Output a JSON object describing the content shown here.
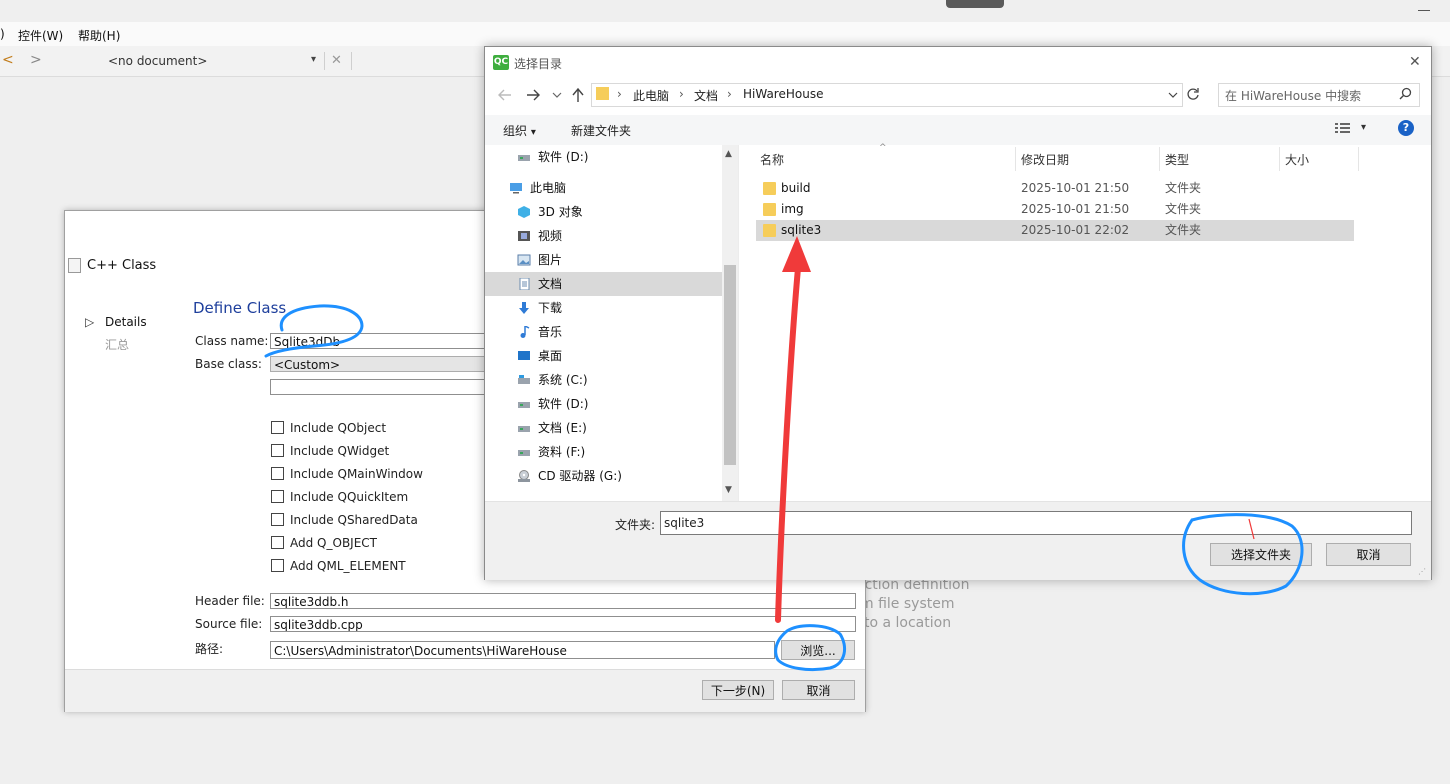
{
  "menu": {
    "items": [
      "控件(W)",
      "帮助(H)"
    ]
  },
  "toolbar": {
    "back": "<",
    "forward": ">",
    "document_combo": "<no document>",
    "combo_arrow": "▾",
    "close": "✕"
  },
  "background": {
    "lines": [
      "action definition",
      "m file system",
      "to a location"
    ]
  },
  "wizard": {
    "title": "C++ Class",
    "steps": [
      "Details",
      "汇总"
    ],
    "step_marker": "▷",
    "section_title": "Define Class",
    "class_name_label": "Class name:",
    "class_name_value": "Sqlite3dDb",
    "base_class_label": "Base class:",
    "base_class_value": "<Custom>",
    "base_class_custom_value": "",
    "checkboxes": [
      "Include QObject",
      "Include QWidget",
      "Include QMainWindow",
      "Include QQuickItem",
      "Include QSharedData",
      "Add Q_OBJECT",
      "Add QML_ELEMENT"
    ],
    "header_file_label": "Header file:",
    "header_file_value": "sqlite3ddb.h",
    "source_file_label": "Source file:",
    "source_file_value": "sqlite3ddb.cpp",
    "path_label": "路径:",
    "path_value": "C:\\Users\\Administrator\\Documents\\HiWareHouse",
    "browse_button": "浏览...",
    "next_button": "下一步(N)",
    "cancel_button": "取消"
  },
  "file_dialog": {
    "app_badge": "QC",
    "title": "选择目录",
    "close": "✕",
    "breadcrumb": [
      "此电脑",
      "文档",
      "HiWareHouse"
    ],
    "breadcrumb_sep": "›",
    "search_placeholder": "在 HiWareHouse 中搜索",
    "organize_label": "组织",
    "organize_arrow": "▾",
    "new_folder_label": "新建文件夹",
    "help": "?",
    "view_arrow": "▾",
    "tree": [
      {
        "label": "软件 (D:)",
        "icon": "drive-icon"
      },
      {
        "label": "此电脑",
        "icon": "computer-icon"
      },
      {
        "label": "3D 对象",
        "icon": "3d-objects-icon"
      },
      {
        "label": "视频",
        "icon": "video-icon"
      },
      {
        "label": "图片",
        "icon": "pictures-icon"
      },
      {
        "label": "文档",
        "icon": "documents-icon"
      },
      {
        "label": "下载",
        "icon": "download-icon"
      },
      {
        "label": "音乐",
        "icon": "music-icon"
      },
      {
        "label": "桌面",
        "icon": "desktop-icon"
      },
      {
        "label": "系统 (C:)",
        "icon": "drive-icon"
      },
      {
        "label": "软件 (D:)",
        "icon": "drive-icon"
      },
      {
        "label": "文档 (E:)",
        "icon": "drive-icon"
      },
      {
        "label": "资料 (F:)",
        "icon": "drive-icon"
      },
      {
        "label": "CD 驱动器 (G:)",
        "icon": "cd-drive-icon"
      }
    ],
    "columns": {
      "name": "名称",
      "modified": "修改日期",
      "type": "类型",
      "size": "大小"
    },
    "files": [
      {
        "name": "build",
        "modified": "2025-10-01 21:50",
        "type": "文件夹"
      },
      {
        "name": "img",
        "modified": "2025-10-01 21:50",
        "type": "文件夹"
      },
      {
        "name": "sqlite3",
        "modified": "2025-10-01 22:02",
        "type": "文件夹"
      }
    ],
    "folder_label": "文件夹:",
    "folder_value": "sqlite3",
    "select_button": "选择文件夹",
    "cancel_button": "取消"
  },
  "colors": {
    "annotation_blue": "#1e90ff",
    "annotation_red": "#f03a3a",
    "selection": "#d9d9d9",
    "link_blue": "#1e3f9c"
  }
}
